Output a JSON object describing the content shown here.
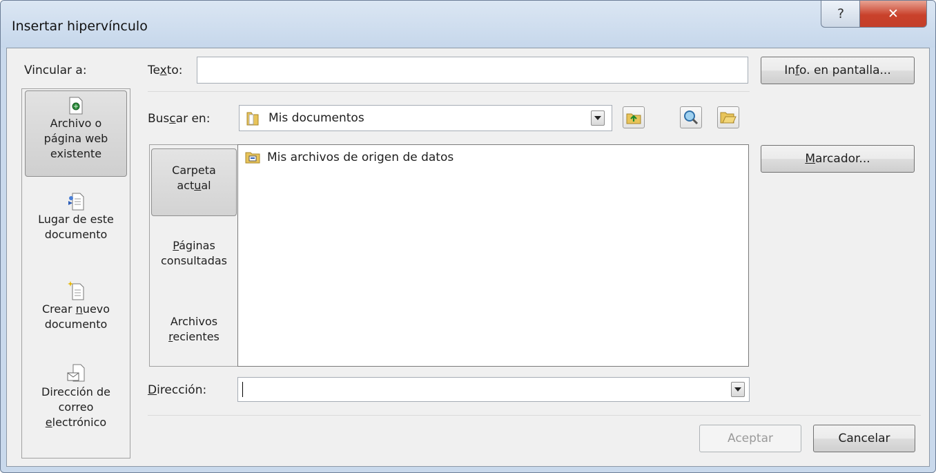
{
  "window": {
    "title": "Insertar hipervínculo",
    "help_glyph": "?",
    "close_glyph": "✕"
  },
  "link_to": {
    "label": "Vincular a:",
    "items": [
      {
        "id": "existing",
        "line1": "Archivo o",
        "line2": "página web",
        "line3": "existente",
        "icon": "web-page-icon",
        "selected": true
      },
      {
        "id": "place",
        "line1": "Lugar de este",
        "line2": "documento",
        "icon": "document-place-icon",
        "selected": false
      },
      {
        "id": "new",
        "line1": "Crear nuevo",
        "line2": "documento",
        "icon": "new-document-icon",
        "selected": false
      },
      {
        "id": "email",
        "line1": "Dirección de",
        "line2": "correo",
        "line3": "electrónico",
        "icon": "email-icon",
        "selected": false
      }
    ]
  },
  "text_field": {
    "label": "Texto:",
    "value": ""
  },
  "screentip_button": "Info. en pantalla...",
  "look_in": {
    "label": "Buscar en:",
    "value": "Mis documentos",
    "folder_icon": "folder-icon"
  },
  "toolbar": {
    "up": "up-folder-icon",
    "browse_web": "browse-web-icon",
    "browse_file": "browse-file-icon"
  },
  "nav": [
    {
      "line1": "Carpeta",
      "line2": "actual",
      "selected": true
    },
    {
      "line1": "Páginas",
      "line2": "consultadas",
      "selected": false
    },
    {
      "line1": "Archivos",
      "line2": "recientes",
      "selected": false
    }
  ],
  "files": [
    {
      "name": "Mis archivos de origen de datos",
      "icon": "data-sources-folder-icon"
    }
  ],
  "bookmark_button": "Marcador...",
  "address": {
    "label": "Dirección:",
    "value": ""
  },
  "ok_button": "Aceptar",
  "cancel_button": "Cancelar",
  "colors": {
    "title_bar": "#c6d7eb",
    "close_button": "#c9412b",
    "dialog_body": "#f0f0f0"
  }
}
